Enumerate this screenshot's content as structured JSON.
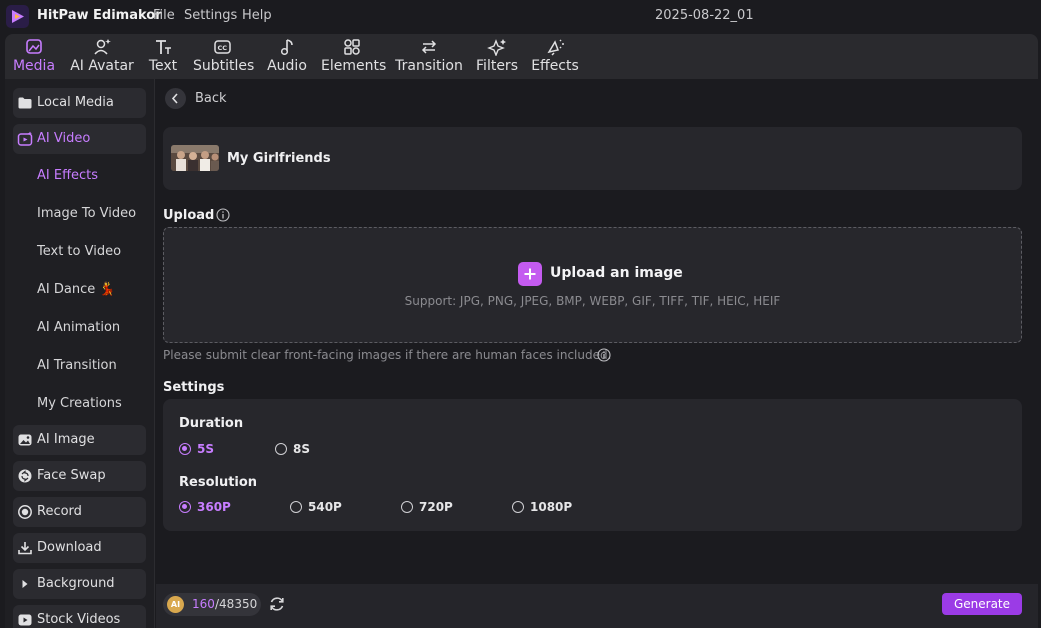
{
  "app": {
    "name": "HitPaw Edimakor",
    "menu": [
      "File",
      "Settings",
      "Help"
    ],
    "document_title": "2025-08-22_01"
  },
  "toolbar": {
    "tabs": [
      {
        "label": "Media",
        "icon": "media-icon",
        "active": true
      },
      {
        "label": "AI Avatar",
        "icon": "ai-avatar-icon"
      },
      {
        "label": "Text",
        "icon": "text-icon"
      },
      {
        "label": "Subtitles",
        "icon": "subtitles-icon"
      },
      {
        "label": "Audio",
        "icon": "audio-icon"
      },
      {
        "label": "Elements",
        "icon": "elements-icon"
      },
      {
        "label": "Transition",
        "icon": "transition-icon"
      },
      {
        "label": "Filters",
        "icon": "filters-icon"
      },
      {
        "label": "Effects",
        "icon": "effects-icon"
      }
    ]
  },
  "sidebar": {
    "items": [
      {
        "label": "Local Media",
        "icon": "folder-icon"
      },
      {
        "label": "AI Video",
        "icon": "ai-video-icon",
        "active": true
      },
      {
        "label": "AI Image",
        "icon": "ai-image-icon"
      },
      {
        "label": "Face Swap",
        "icon": "face-swap-icon"
      },
      {
        "label": "Record",
        "icon": "record-icon"
      },
      {
        "label": "Download",
        "icon": "download-icon"
      },
      {
        "label": "Background",
        "icon": "background-icon"
      },
      {
        "label": "Stock Videos",
        "icon": "stock-videos-icon"
      }
    ],
    "ai_video_sub": [
      {
        "label": "AI Effects",
        "active": true
      },
      {
        "label": "Image To Video"
      },
      {
        "label": "Text to Video"
      },
      {
        "label": "AI Dance 💃"
      },
      {
        "label": "AI Animation"
      },
      {
        "label": "AI Transition"
      },
      {
        "label": "My Creations"
      }
    ]
  },
  "main": {
    "back_label": "Back",
    "effect_name": "My Girlfriends",
    "upload": {
      "section_title": "Upload",
      "title": "Upload an image",
      "support": "Support: JPG, PNG, JPEG, BMP, WEBP, GIF, TIFF, TIF, HEIC, HEIF",
      "hint": "Please submit clear front-facing images if there are human faces included."
    },
    "settings": {
      "section_title": "Settings",
      "duration_label": "Duration",
      "duration_options": [
        {
          "label": "5S",
          "selected": true
        },
        {
          "label": "8S",
          "selected": false
        }
      ],
      "resolution_label": "Resolution",
      "resolution_options": [
        {
          "label": "360P",
          "selected": true
        },
        {
          "label": "540P",
          "selected": false
        },
        {
          "label": "720P",
          "selected": false
        },
        {
          "label": "1080P",
          "selected": false
        }
      ]
    }
  },
  "footer": {
    "coin_label": "AI",
    "credits_used": "160",
    "credits_total": "/48350",
    "generate_label": "Generate"
  },
  "colors": {
    "accent": "#c77dff",
    "button": "#9b3be6",
    "background": "#1b1b1f",
    "panel": "#27272c"
  }
}
